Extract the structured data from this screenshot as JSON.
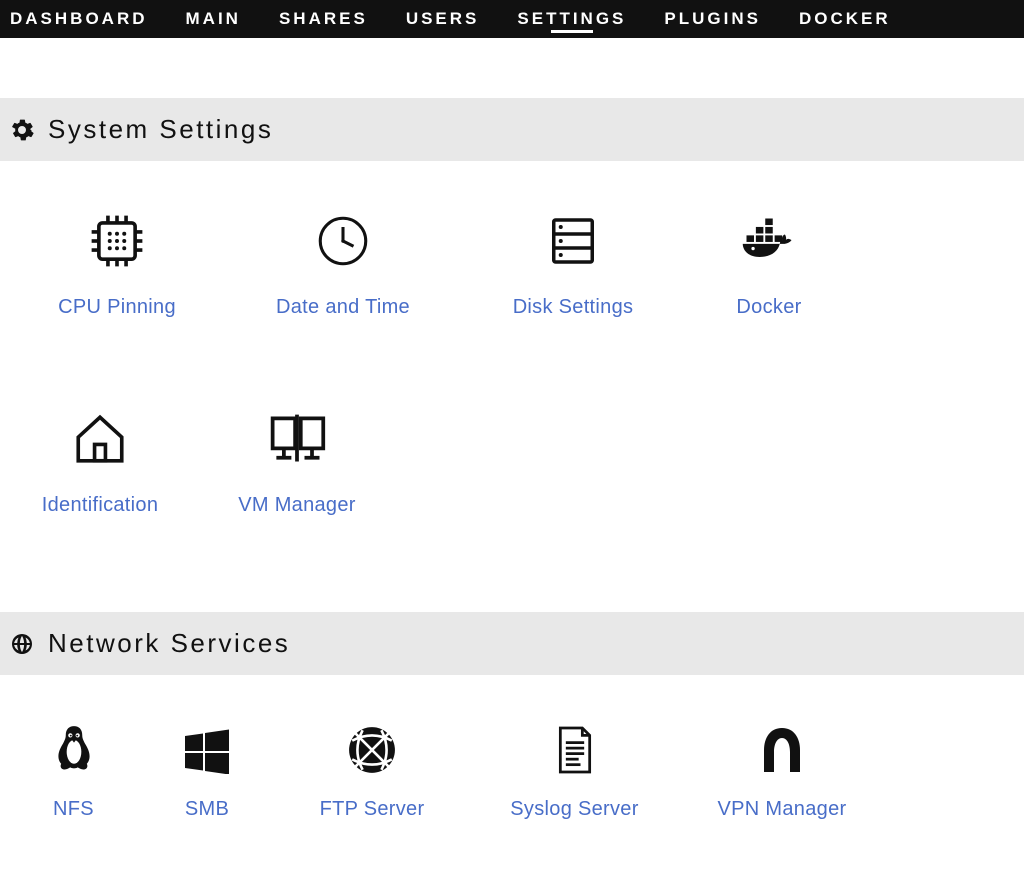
{
  "nav": {
    "items": [
      "DASHBOARD",
      "MAIN",
      "SHARES",
      "USERS",
      "SETTINGS",
      "PLUGINS",
      "DOCKER"
    ],
    "active_index": 4
  },
  "sections": [
    {
      "title": "System Settings",
      "icon": "gear-icon",
      "items": [
        {
          "label": "CPU Pinning",
          "icon": "cpu-icon"
        },
        {
          "label": "Date and Time",
          "icon": "clock-icon"
        },
        {
          "label": "Disk Settings",
          "icon": "disk-icon"
        },
        {
          "label": "Docker",
          "icon": "docker-icon"
        },
        {
          "label": "Identification",
          "icon": "home-icon"
        },
        {
          "label": "VM Manager",
          "icon": "vm-icon"
        }
      ]
    },
    {
      "title": "Network Services",
      "icon": "globe-icon",
      "items": [
        {
          "label": "NFS",
          "icon": "penguin-icon"
        },
        {
          "label": "SMB",
          "icon": "windows-icon"
        },
        {
          "label": "FTP Server",
          "icon": "network-icon"
        },
        {
          "label": "Syslog Server",
          "icon": "file-icon"
        },
        {
          "label": "VPN Manager",
          "icon": "tunnel-icon"
        }
      ]
    }
  ]
}
